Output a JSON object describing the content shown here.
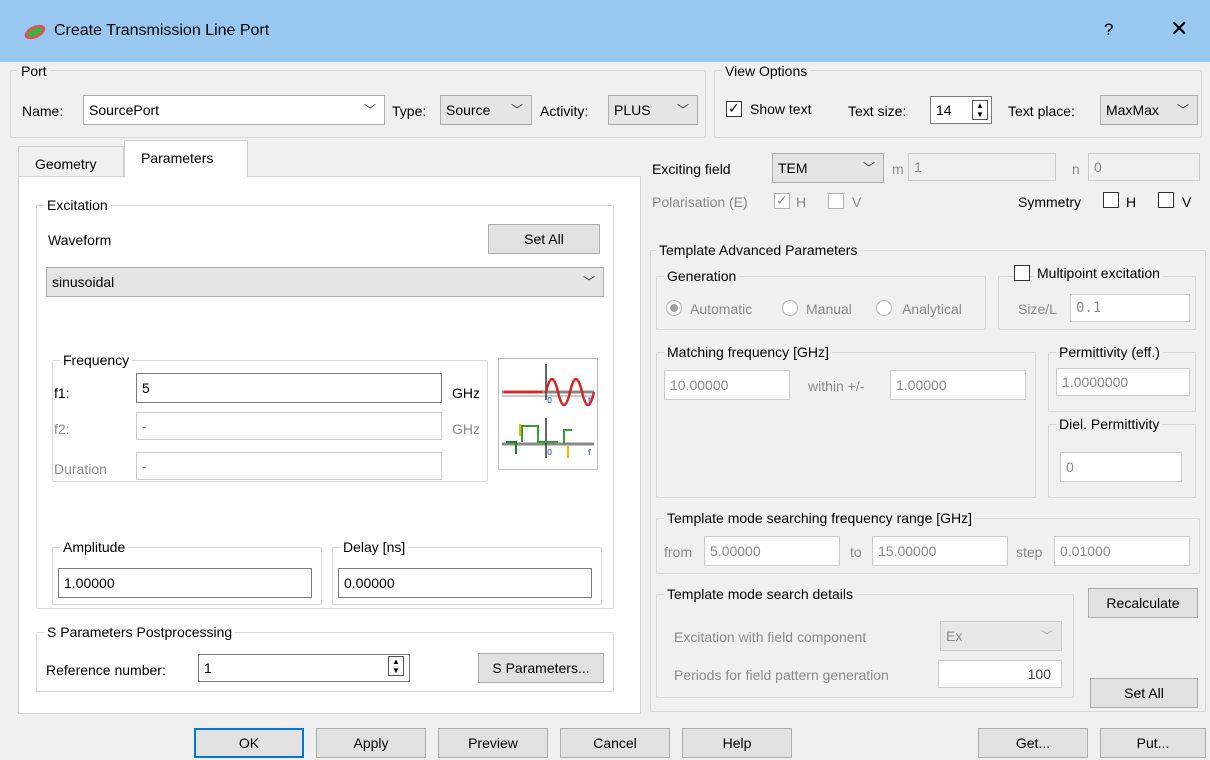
{
  "window": {
    "title": "Create Transmission Line Port",
    "help": "?",
    "close": "✕"
  },
  "port": {
    "group_title": "Port",
    "name_label": "Name:",
    "name_value": "SourcePort",
    "type_label": "Type:",
    "type_value": "Source",
    "activity_label": "Activity:",
    "activity_value": "PLUS"
  },
  "view_options": {
    "group_title": "View Options",
    "show_text_label": "Show text",
    "text_size_label": "Text size:",
    "text_size_value": "14",
    "text_place_label": "Text place:",
    "text_place_value": "MaxMax"
  },
  "tabs": [
    {
      "label": "Geometry"
    },
    {
      "label": "Parameters"
    }
  ],
  "excitation": {
    "group_title": "Excitation",
    "waveform_label": "Waveform",
    "set_all_label": "Set All",
    "waveform_value": "sinusoidal",
    "frequency": {
      "group_title": "Frequency",
      "f1_label": "f1:",
      "f1_value": "5",
      "f1_unit": "GHz",
      "f2_label": "f2:",
      "f2_value": "-",
      "f2_unit": "GHz",
      "duration_label": "Duration",
      "duration_value": "-"
    },
    "amplitude": {
      "group_title": "Amplitude",
      "value": "1.00000"
    },
    "delay": {
      "group_title": "Delay [ns]",
      "value": "0.00000"
    }
  },
  "s_params": {
    "group_title": "S Parameters Postprocessing",
    "ref_label": "Reference number:",
    "ref_value": "1",
    "button_label": "S Parameters..."
  },
  "field": {
    "exciting_label": "Exciting field",
    "exciting_value": "TEM",
    "m_label": "m",
    "m_value": "1",
    "n_label": "n",
    "n_value": "0",
    "polarisation_label": "Polarisation (E)",
    "h_label": "H",
    "v_label": "V",
    "symmetry_label": "Symmetry",
    "sym_h_label": "H",
    "sym_v_label": "V"
  },
  "template": {
    "group_title": "Template Advanced Parameters",
    "generation": {
      "group_title": "Generation",
      "automatic": "Automatic",
      "manual": "Manual",
      "analytical": "Analytical"
    },
    "multipoint": {
      "label": "Multipoint excitation",
      "size_label": "Size/L",
      "size_value": "0.1"
    },
    "matching": {
      "group_title": "Matching frequency [GHz]",
      "value": "10.00000",
      "within_label": "within +/-",
      "within_value": "1.00000"
    },
    "permittivity": {
      "group_title": "Permittivity (eff.)",
      "value": "1.0000000"
    },
    "diel": {
      "group_title": "Diel. Permittivity",
      "value": "0"
    },
    "search_range": {
      "group_title": "Template mode searching frequency range [GHz]",
      "from_label": "from",
      "from_value": "5.00000",
      "to_label": "to",
      "to_value": "15.00000",
      "step_label": "step",
      "step_value": "0.01000"
    },
    "search_details": {
      "group_title": "Template mode search details",
      "excitation_label": "Excitation with field component",
      "excitation_value": "Ex",
      "periods_label": "Periods for field pattern generation",
      "periods_value": "100"
    },
    "recalculate_label": "Recalculate",
    "set_all_label": "Set All"
  },
  "footer": {
    "ok": "OK",
    "apply": "Apply",
    "preview": "Preview",
    "cancel": "Cancel",
    "help": "Help",
    "get": "Get...",
    "put": "Put..."
  }
}
